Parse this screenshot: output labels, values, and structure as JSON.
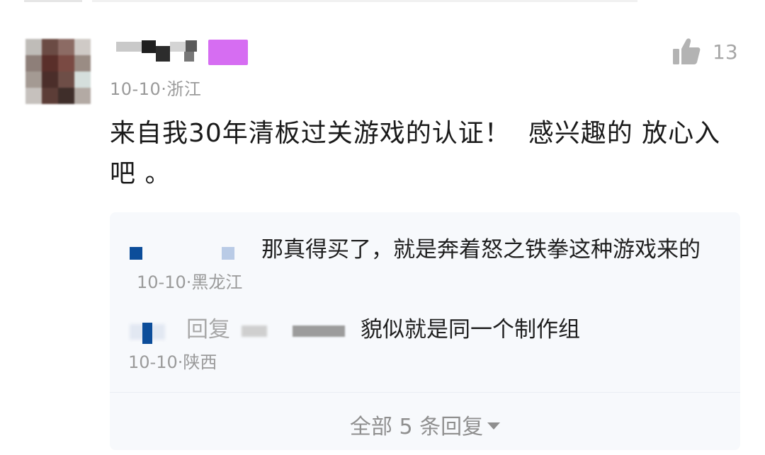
{
  "comment": {
    "meta": "10-10·浙江",
    "likes": "13",
    "text": "来自我30年清板过关游戏的认证！  感兴趣的 放心入吧 。"
  },
  "replies": [
    {
      "text": "那真得买了，就是奔着怒之铁拳这种游戏来的",
      "meta": "10-10·黑龙江"
    },
    {
      "reply_label": "回复",
      "text": "貌似就是同一个制作组",
      "meta": "10-10·陕西"
    }
  ],
  "all_replies_label": "全部 5 条回复",
  "icons": {
    "like": "thumbs-up-icon",
    "expand": "caret-down-icon"
  },
  "colors": {
    "vip_badge": "#d66df2",
    "muted_text": "#9a9a9a",
    "reply_bg": "#f7f9fc"
  }
}
